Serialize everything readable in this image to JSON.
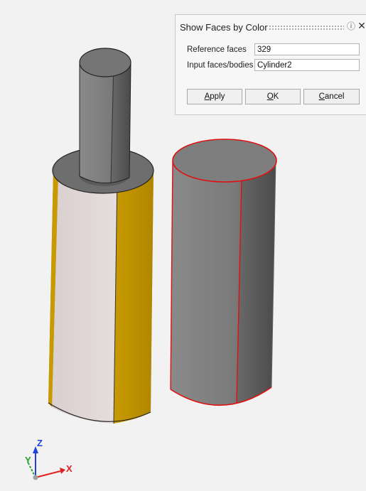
{
  "dialog": {
    "title": "Show Faces by Color",
    "help_icon": "help-icon",
    "close_icon": "close-icon",
    "fields": [
      {
        "label": "Reference faces",
        "value": "329"
      },
      {
        "label": "Input faces/bodies",
        "value": "Cylinder2"
      }
    ],
    "buttons": [
      {
        "mnemonic": "A",
        "rest": "pply"
      },
      {
        "mnemonic": "O",
        "rest": "K"
      },
      {
        "mnemonic": "C",
        "rest": "ancel"
      }
    ]
  },
  "triad": {
    "z_label": "Z",
    "y_label": "Y",
    "x_label": "X"
  },
  "colors": {
    "reference_face": "#e0d6d6",
    "highlight_face": "#c89a00",
    "highlight_edge": "#e01010",
    "body_gray": "#7e7e7e",
    "axis_x": "#e02020",
    "axis_y": "#20a020",
    "axis_z": "#2040e0"
  }
}
